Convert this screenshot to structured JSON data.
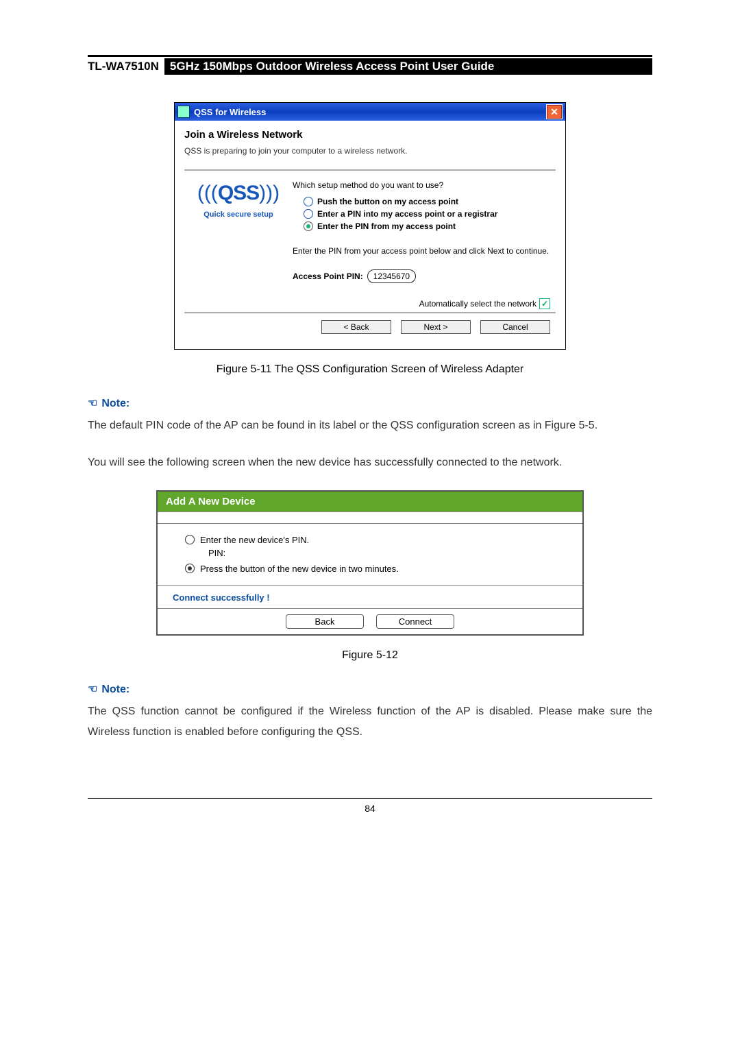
{
  "header": {
    "model": "TL-WA7510N",
    "title": "5GHz 150Mbps Outdoor Wireless Access Point User Guide"
  },
  "dialog1": {
    "window_title": "QSS for Wireless",
    "heading": "Join a Wireless Network",
    "subheading": "QSS is preparing to join your computer to a wireless network.",
    "logo_text": "QSS",
    "logo_tag": "Quick secure setup",
    "question": "Which setup method do you want to use?",
    "opt1": "Push the button on my access point",
    "opt2": "Enter a PIN into my access point or a registrar",
    "opt3": "Enter the PIN from my access point",
    "pin_instruction": "Enter the PIN from your access point below and click Next to continue.",
    "pin_label": "Access Point PIN:",
    "pin_value": "12345670",
    "auto_select": "Automatically select the network",
    "btn_back": "< Back",
    "btn_next": "Next >",
    "btn_cancel": "Cancel"
  },
  "caption1": "Figure 5-11 The QSS Configuration Screen of Wireless Adapter",
  "note1": {
    "label": "Note:",
    "text": "The default PIN code of the AP can be found in its label or the QSS configuration screen as in Figure 5-5."
  },
  "body_text": "You will see the following screen when the new device has successfully connected to the network.",
  "dialog2": {
    "title": "Add A New Device",
    "opt1": "Enter the new device's PIN.",
    "pin_label": "PIN:",
    "opt2": "Press the button of the new device in two minutes.",
    "status": "Connect successfully !",
    "btn_back": "Back",
    "btn_connect": "Connect"
  },
  "caption2": "Figure 5-12",
  "note2": {
    "label": "Note:",
    "text": "The QSS function cannot be configured if the Wireless function of the AP is disabled. Please make sure the Wireless function is enabled before configuring the QSS."
  },
  "page_number": "84"
}
